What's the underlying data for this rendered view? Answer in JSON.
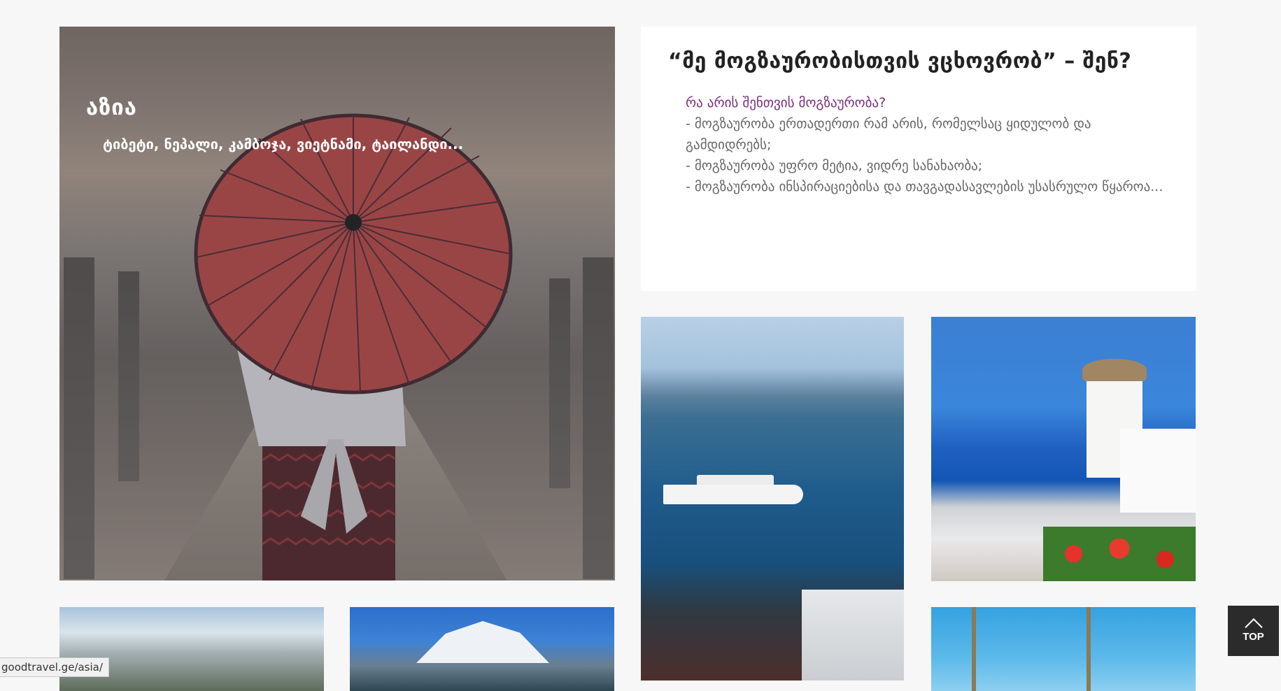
{
  "asia_tile": {
    "title": "აზია",
    "subtitle": "ტიბეტი, ნეპალი, კამბოჯა, ვიეტნამი, ტაილანდი..."
  },
  "quote_card": {
    "heading": "“მე მოგზაურობისთვის ვცხოვრობ” – შენ?",
    "question": "რა არის შენთვის მოგზაურობა?",
    "lines": [
      "- მოგზაურობა ერთადერთი რამ არის, რომელსაც ყიდულობ და გამდიდრებს;",
      "- მოგზაურობა უფრო მეტია, ვიდრე სანახაობა;",
      "- მოგზაურობა ინსპირაციებისა და თავგადასავლების უსასრულო წყაროა..."
    ]
  },
  "top_button": {
    "label": "TOP"
  },
  "status_bar": {
    "url": "goodtravel.ge/asia/"
  },
  "colors": {
    "page_background": "#f7f7f7",
    "quote_accent": "#7a2d7d",
    "top_button_bg": "#2b2b2b",
    "umbrella": "#c5514e"
  }
}
